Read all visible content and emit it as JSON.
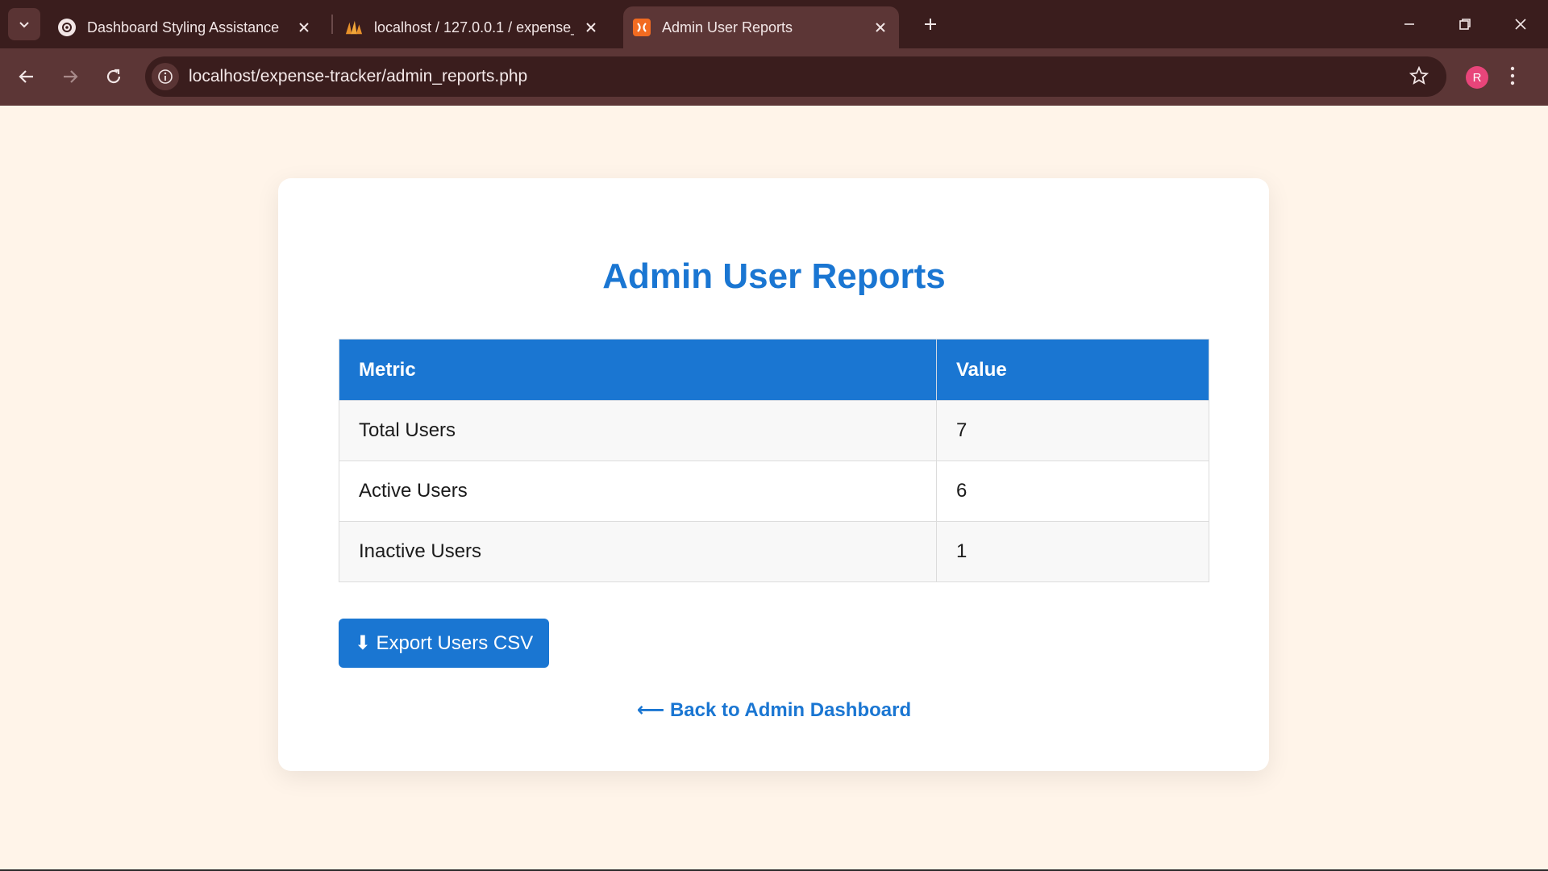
{
  "browser": {
    "tabs": [
      {
        "title": "Dashboard Styling Assistance",
        "icon": "openai-icon"
      },
      {
        "title": "localhost / 127.0.0.1 / expense_",
        "icon": "phpmyadmin-icon"
      },
      {
        "title": "Admin User Reports",
        "icon": "xampp-icon",
        "active": true
      }
    ],
    "url": "localhost/expense-tracker/admin_reports.php",
    "profile_initial": "R"
  },
  "page": {
    "title": "Admin User Reports",
    "table": {
      "headers": [
        "Metric",
        "Value"
      ],
      "rows": [
        {
          "metric": "Total Users",
          "value": "7"
        },
        {
          "metric": "Active Users",
          "value": "6"
        },
        {
          "metric": "Inactive Users",
          "value": "1"
        }
      ]
    },
    "export_label": "⬇ Export Users CSV",
    "back_label": "⟵ Back to Admin Dashboard"
  },
  "colors": {
    "accent": "#1a76d2",
    "page_bg": "#fff4e9",
    "chrome_dark": "#3a1d1d",
    "chrome_mid": "#5c3636"
  }
}
